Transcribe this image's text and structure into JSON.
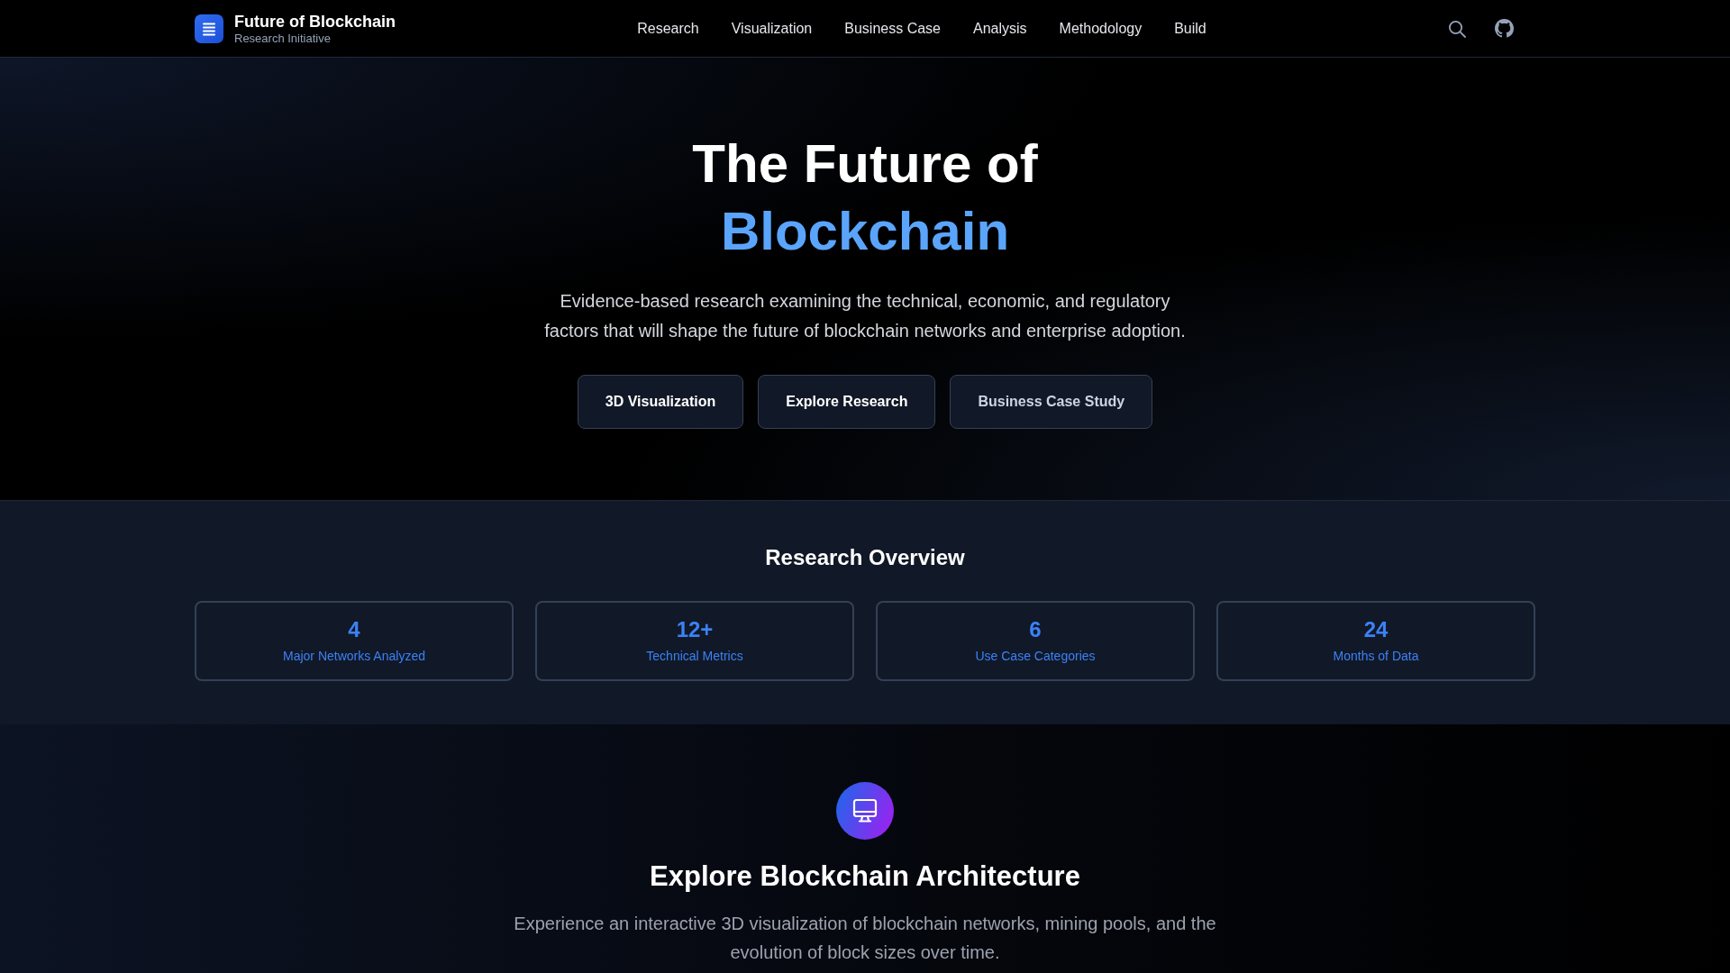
{
  "navbar": {
    "brand": {
      "title": "Future of Blockchain",
      "subtitle": "Research Initiative"
    },
    "links": [
      "Research",
      "Visualization",
      "Business Case",
      "Analysis",
      "Methodology",
      "Build"
    ]
  },
  "hero": {
    "title": "The Future of",
    "title_highlight": "Blockchain",
    "description": "Evidence-based research examining the technical, economic, and regulatory factors that will shape the future of blockchain networks and enterprise adoption.",
    "buttons": [
      {
        "label": "3D Visualization",
        "kind": "primary"
      },
      {
        "label": "Explore Research",
        "kind": "primary"
      },
      {
        "label": "Business Case Study",
        "kind": "secondary"
      }
    ]
  },
  "overview": {
    "title": "Research Overview",
    "stats": [
      {
        "value": "4",
        "label": "Major Networks Analyzed"
      },
      {
        "value": "12+",
        "label": "Technical Metrics"
      },
      {
        "value": "6",
        "label": "Use Case Categories"
      },
      {
        "value": "24",
        "label": "Months of Data"
      }
    ]
  },
  "architecture": {
    "title": "Explore Blockchain Architecture",
    "description": "Experience an interactive 3D visualization of blockchain networks, mining pools, and the evolution of block sizes over time."
  }
}
